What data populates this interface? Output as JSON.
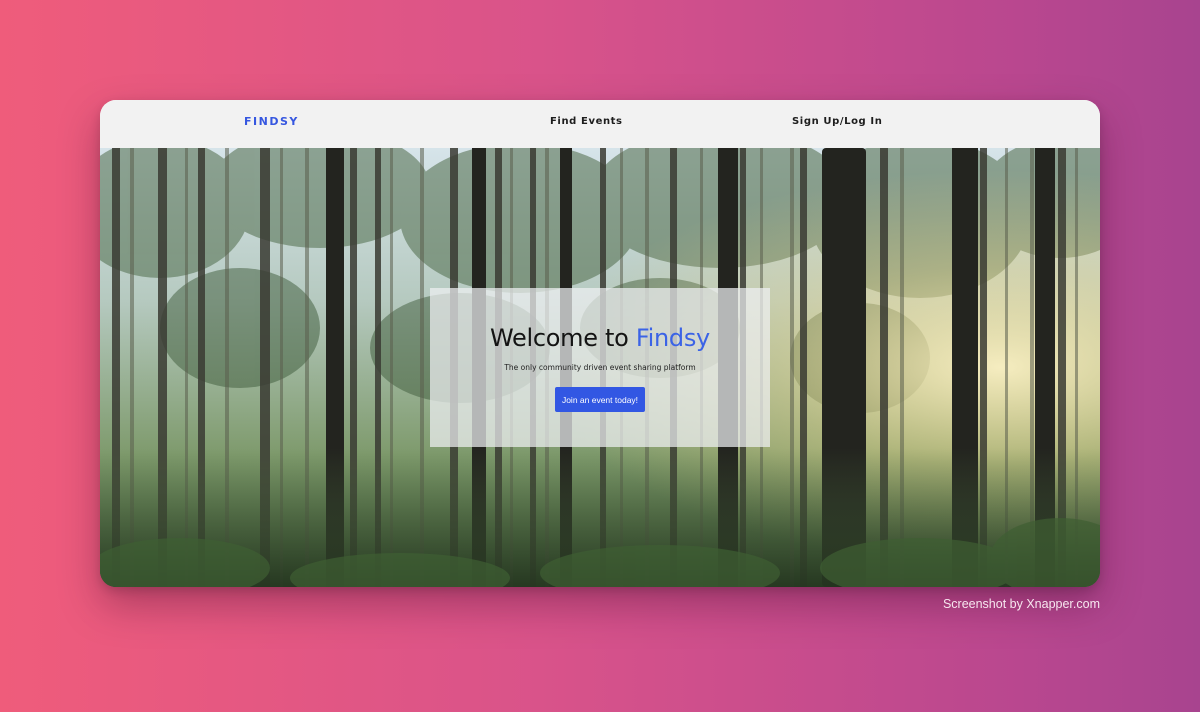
{
  "nav": {
    "logo": "FINDSY",
    "find_events": "Find Events",
    "signup_login": "Sign Up/Log In"
  },
  "hero": {
    "title_prefix": "Welcome to ",
    "title_brand": "Findsy",
    "subtitle": "The only community driven event sharing platform",
    "cta_label": "Join an event today!",
    "background": "forest-photo"
  },
  "colors": {
    "accent": "#3257e3",
    "brand_text": "#3b63e6",
    "nav_bg": "#f2f2f2"
  },
  "watermark": "Screenshot by Xnapper.com"
}
